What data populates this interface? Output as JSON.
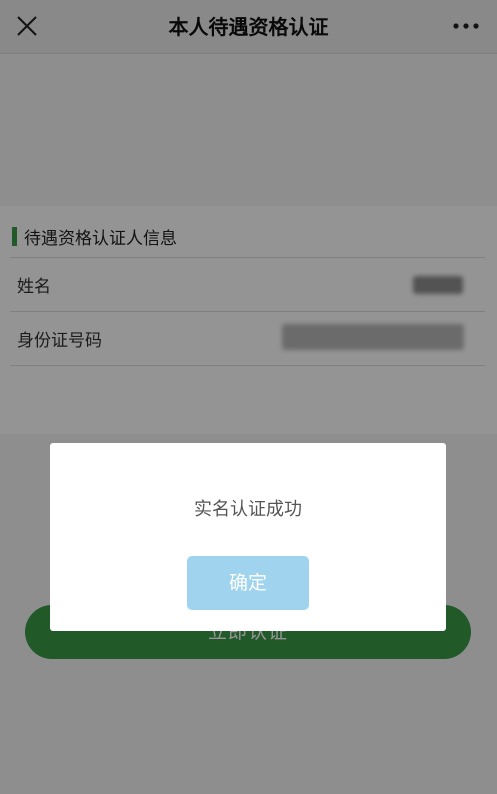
{
  "navbar": {
    "title": "本人待遇资格认证",
    "close_icon": "close-icon",
    "more_icon": "more-icon"
  },
  "info_section": {
    "title": "待遇资格认证人信息",
    "fields": [
      {
        "label": "姓名"
      },
      {
        "label": "身份证号码"
      }
    ]
  },
  "submit_button": {
    "label": "立即认证"
  },
  "dialog": {
    "message": "实名认证成功",
    "confirm_label": "确定"
  },
  "colors": {
    "accent_green": "#3a9a48",
    "confirm_button": "#9fd3ee",
    "navbar_bg": "#ededed"
  }
}
